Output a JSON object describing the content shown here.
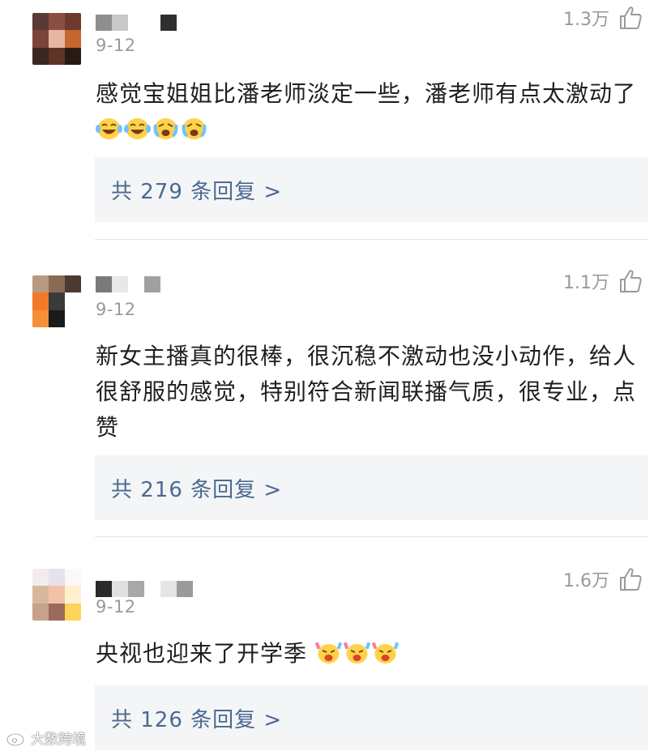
{
  "comments": [
    {
      "date": "9-12",
      "likes": "1.3万",
      "content": "感觉宝姐姐比潘老师淡定一些，潘老师有点太激动了",
      "emojis": [
        "laughing-tears-emoji",
        "laughing-tears-emoji",
        "crying-laughing-emoji",
        "crying-laughing-emoji"
      ],
      "reply_label": "共 279 条回复 >"
    },
    {
      "date": "9-12",
      "likes": "1.1万",
      "content": "新女主播真的很棒，很沉稳不激动也没小动作，给人很舒服的感觉，特别符合新闻联播气质，很专业，点赞",
      "emojis": [],
      "reply_label": "共 216 条回复 >"
    },
    {
      "date": "9-12",
      "likes": "1.6万",
      "content": "央视也迎来了开学季",
      "emojis": [
        "party-face-emoji",
        "party-face-emoji",
        "party-face-emoji"
      ],
      "reply_label": "共 126 条回复 >"
    }
  ],
  "watermark": "大数跨境",
  "colors": {
    "reply_text": "#4a6a92",
    "reply_bg": "#f4f5f6",
    "meta_text": "#9a9a9a",
    "body_text": "#1f1f1f"
  }
}
